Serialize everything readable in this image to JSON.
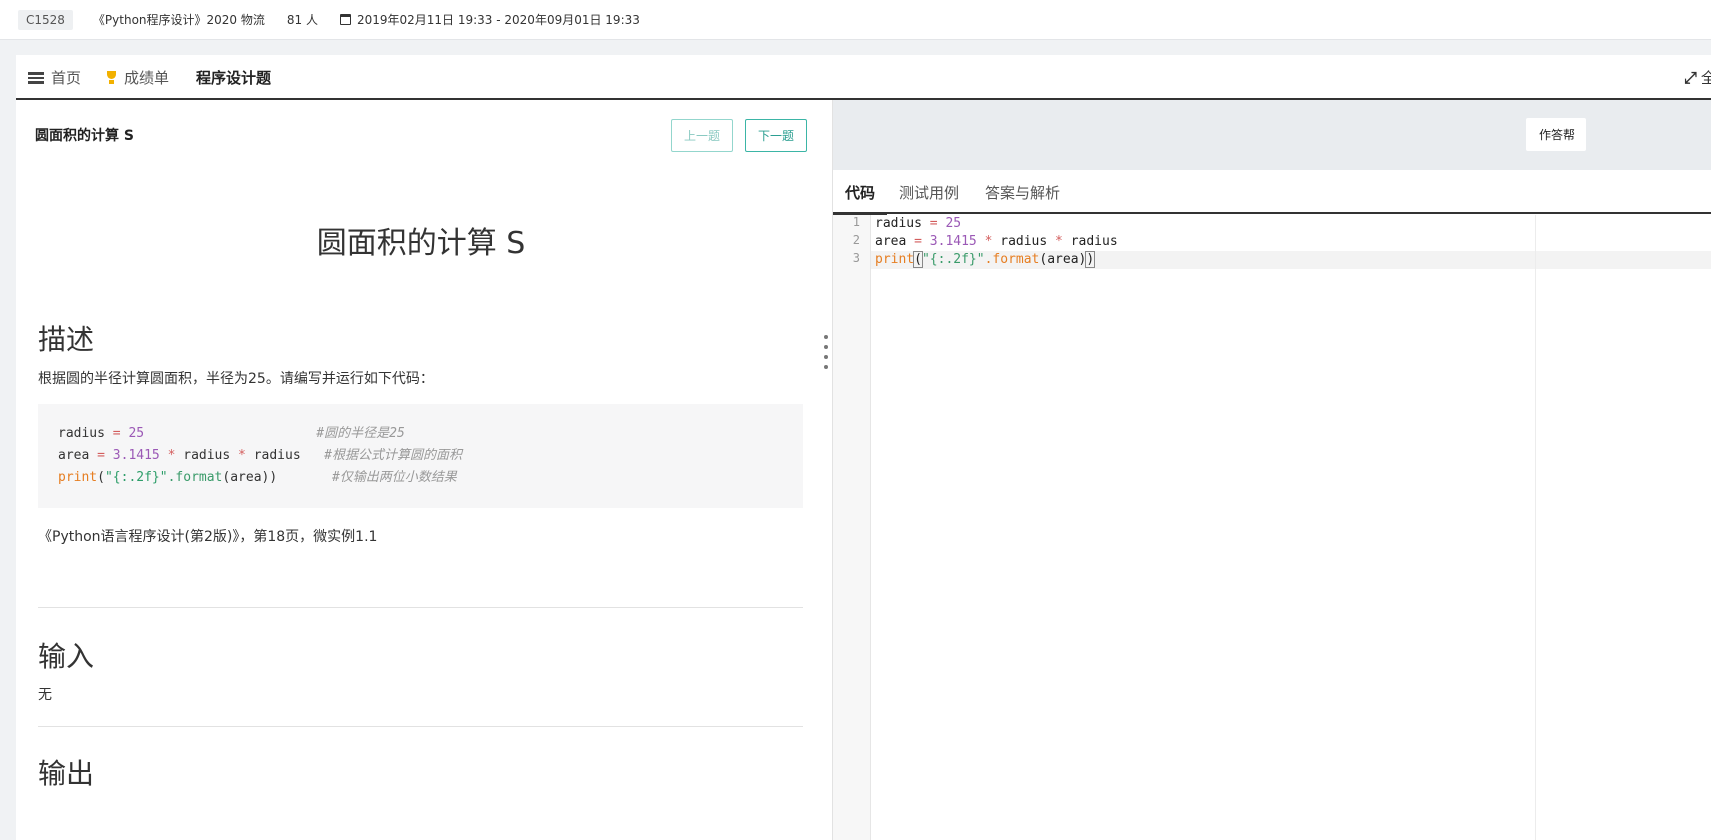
{
  "topbar": {
    "course_code": "C1528",
    "course_name": "《Python程序设计》2020 物流",
    "student_count": "81 人",
    "date_range": "2019年02月11日 19:33 - 2020年09月01日 19:33"
  },
  "nav": {
    "tabs": [
      {
        "label": "首页",
        "icon": "home-icon"
      },
      {
        "label": "成绩单",
        "icon": "trophy-icon"
      },
      {
        "label": "程序设计题",
        "active": true
      }
    ],
    "fullscreen_label": "全"
  },
  "problem": {
    "title_small": "圆面积的计算 S",
    "prev_label": "上一题",
    "next_label": "下一题",
    "title": "圆面积的计算 S",
    "description_heading": "描述",
    "description_text": "根据圆的半径计算圆面积，半径为25。请编写并运行如下代码：",
    "sample_code": {
      "l1": {
        "var": "radius",
        "op": "=",
        "num": "25",
        "comment": "#圆的半径是25"
      },
      "l2": {
        "var": "area",
        "op": "=",
        "num": "3.1415",
        "op2": "*",
        "var2": "radius",
        "op3": "*",
        "var3": "radius",
        "comment": "#根据公式计算圆的面积"
      },
      "l3": {
        "kw": "print",
        "open": "(",
        "str": "\"{:.2f}\"",
        "fn": ".format",
        "args": "(area))",
        "comment": "#仅输出两位小数结果"
      }
    },
    "reference": "《Python语言程序设计(第2版)》，第18页，微实例1.1",
    "input_heading": "输入",
    "input_text": "无",
    "output_heading": "输出"
  },
  "right": {
    "answer_sheet_label": "作答帮",
    "code_tabs": [
      "代码",
      "测试用例",
      "答案与解析"
    ],
    "editor_lines": {
      "n1": "1",
      "n2": "2",
      "n3": "3",
      "l1": {
        "var": "radius",
        "op": "=",
        "num": "25"
      },
      "l2": {
        "var": "area",
        "op": "=",
        "num": "3.1415",
        "op2": "*",
        "var2": "radius",
        "op3": "*",
        "var3": "radius"
      },
      "l3": {
        "kw": "print",
        "open": "(",
        "str": "\"{:.2f}\"",
        "fn": ".format",
        "args": "(area)",
        "close": ")"
      }
    }
  },
  "colors": {
    "accent": "#3bb5a6",
    "number": "#9b59b6",
    "operator": "#d35d5d",
    "keyword": "#e67e22",
    "string": "#3a9b6a"
  }
}
